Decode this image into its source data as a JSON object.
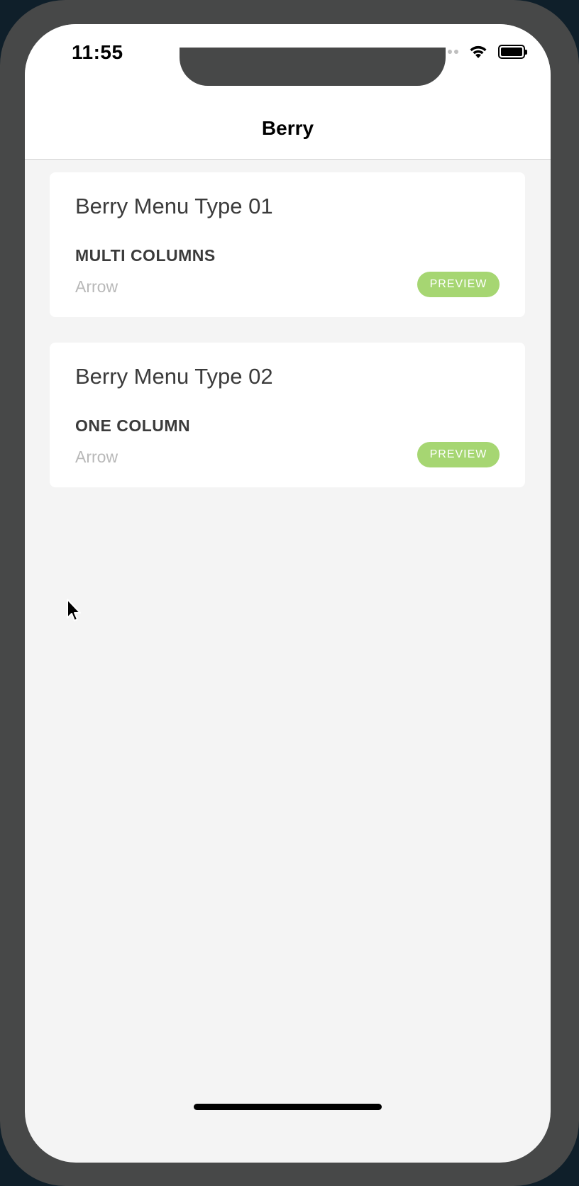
{
  "status_bar": {
    "time": "11:55"
  },
  "nav": {
    "title": "Berry"
  },
  "cards": [
    {
      "title": "Berry Menu Type 01",
      "subtitle": "MULTI COLUMNS",
      "style": "Arrow",
      "button_label": "PREVIEW"
    },
    {
      "title": "Berry Menu Type 02",
      "subtitle": "ONE COLUMN",
      "style": "Arrow",
      "button_label": "PREVIEW"
    }
  ],
  "colors": {
    "accent": "#a6d672",
    "background": "#f4f4f4",
    "card": "#ffffff",
    "device_frame": "#474848"
  },
  "icons": {
    "status": [
      "signal-dots-icon",
      "wifi-icon",
      "battery-icon"
    ],
    "pointer": "mouse-cursor-icon"
  }
}
